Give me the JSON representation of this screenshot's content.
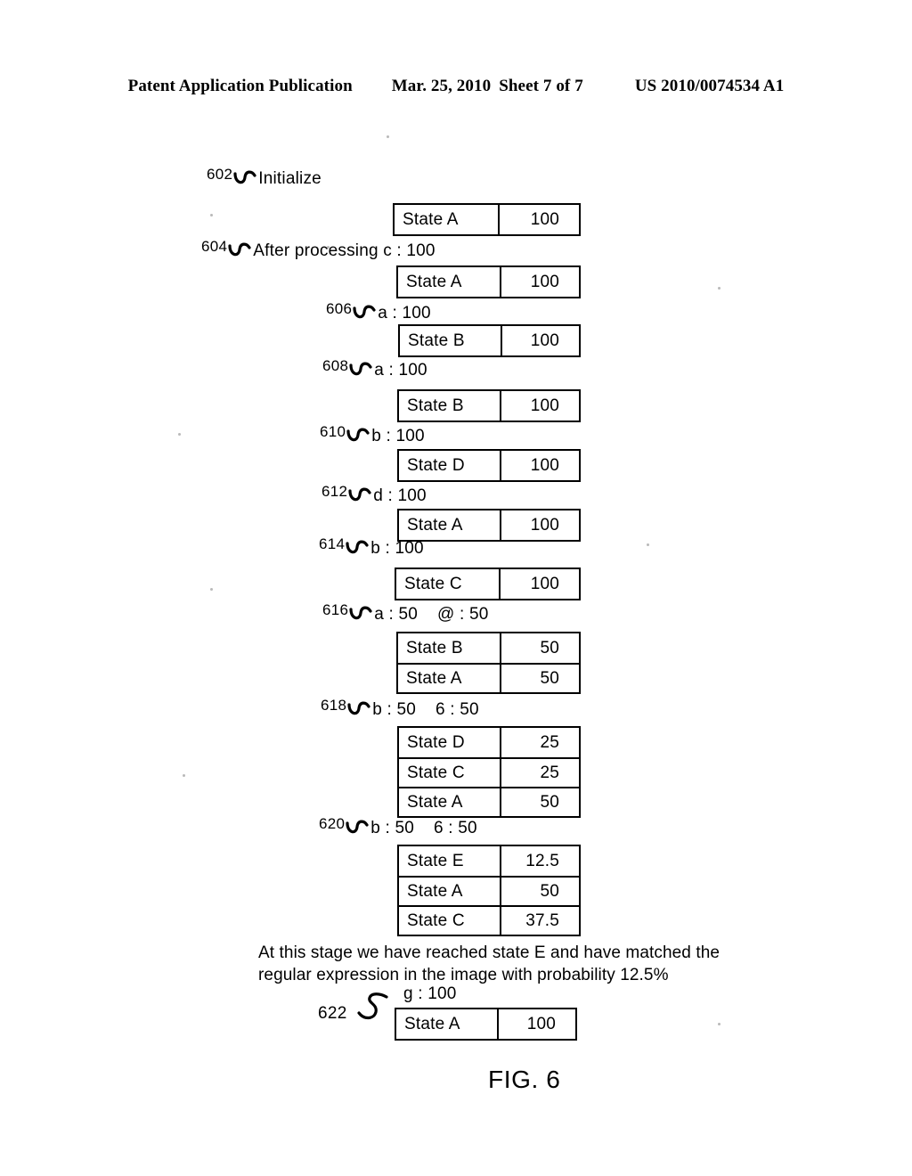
{
  "header": {
    "publication": "Patent Application Publication",
    "date": "Mar. 25, 2010",
    "sheet": "Sheet 7 of 7",
    "doc_number": "US 2010/0074534 A1"
  },
  "figure": {
    "caption": "FIG. 6",
    "narrative": "At this stage we have reached state E and have matched the\nregular expression in the image with probability 12.5%"
  },
  "steps": [
    {
      "ref": "602",
      "text": "Initialize"
    },
    {
      "ref": "604",
      "text": "After processing c : 100"
    },
    {
      "ref": "606",
      "text": "a : 100"
    },
    {
      "ref": "608",
      "text": "a : 100"
    },
    {
      "ref": "610",
      "text": "b : 100"
    },
    {
      "ref": "612",
      "text": "d : 100"
    },
    {
      "ref": "614",
      "text": "b : 100"
    },
    {
      "ref": "616",
      "text_a": "a : 50",
      "text_b": "@ : 50"
    },
    {
      "ref": "618",
      "text_a": "b : 50",
      "text_b": "6 : 50"
    },
    {
      "ref": "620",
      "text_a": "b : 50",
      "text_b": "6 : 50"
    },
    {
      "ref": "622",
      "text": "g : 100"
    }
  ],
  "tables": [
    {
      "id": "table-602",
      "rows": [
        {
          "state": "State A",
          "value": "100"
        }
      ]
    },
    {
      "id": "table-604",
      "rows": [
        {
          "state": "State A",
          "value": "100"
        }
      ]
    },
    {
      "id": "table-606",
      "rows": [
        {
          "state": "State B",
          "value": "100"
        }
      ]
    },
    {
      "id": "table-608",
      "rows": [
        {
          "state": "State B",
          "value": "100"
        }
      ]
    },
    {
      "id": "table-610",
      "rows": [
        {
          "state": "State D",
          "value": "100"
        }
      ]
    },
    {
      "id": "table-612",
      "rows": [
        {
          "state": "State A",
          "value": "100"
        }
      ]
    },
    {
      "id": "table-614",
      "rows": [
        {
          "state": "State C",
          "value": "100"
        }
      ]
    },
    {
      "id": "table-616",
      "rows": [
        {
          "state": "State B",
          "value": "50"
        },
        {
          "state": "State A",
          "value": "50"
        }
      ]
    },
    {
      "id": "table-618",
      "rows": [
        {
          "state": "State D",
          "value": "25"
        },
        {
          "state": "State C",
          "value": "25"
        },
        {
          "state": "State A",
          "value": "50"
        }
      ]
    },
    {
      "id": "table-620",
      "rows": [
        {
          "state": "State E",
          "value": "12.5"
        },
        {
          "state": "State A",
          "value": "50"
        },
        {
          "state": "State C",
          "value": "37.5"
        }
      ]
    },
    {
      "id": "table-622",
      "rows": [
        {
          "state": "State A",
          "value": "100"
        }
      ]
    }
  ]
}
